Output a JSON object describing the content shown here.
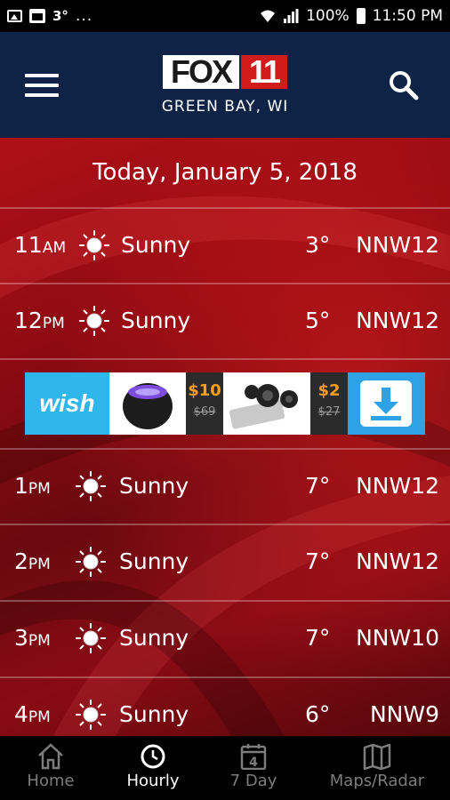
{
  "status_bar": {
    "temperature": "3°",
    "dots": "...",
    "battery": "100%",
    "time": "11:50 PM"
  },
  "header": {
    "logo_fox": "FOX",
    "logo_number": "11",
    "location": "GREEN BAY, WI"
  },
  "main": {
    "date": "Today, January 5, 2018",
    "hours": [
      {
        "hour": "11",
        "period": "AM",
        "condition": "Sunny",
        "temp": "3°",
        "wind": "NNW12"
      },
      {
        "hour": "12",
        "period": "PM",
        "condition": "Sunny",
        "temp": "5°",
        "wind": "NNW12"
      },
      {
        "hour": "1",
        "period": "PM",
        "condition": "Sunny",
        "temp": "7°",
        "wind": "NNW12"
      },
      {
        "hour": "2",
        "period": "PM",
        "condition": "Sunny",
        "temp": "7°",
        "wind": "NNW12"
      },
      {
        "hour": "3",
        "period": "PM",
        "condition": "Sunny",
        "temp": "7°",
        "wind": "NNW10"
      },
      {
        "hour": "4",
        "period": "PM",
        "condition": "Sunny",
        "temp": "6°",
        "wind": "NNW9"
      }
    ]
  },
  "ad": {
    "brand": "wish",
    "price1_now": "$10",
    "price1_was": "$69",
    "price2_now": "$2",
    "price2_was": "$27"
  },
  "bottom_nav": {
    "home": "Home",
    "hourly": "Hourly",
    "seven_day": "7 Day",
    "seven_day_icon_number": "4",
    "maps": "Maps/Radar"
  },
  "colors": {
    "header_bg": "#0f2346",
    "logo_red": "#d21b1b",
    "main_red": "#9e0d15",
    "wish_blue": "#2fb7ec",
    "price_orange": "#ff9d1a",
    "nav_inactive": "#7c7c7c"
  },
  "icons": [
    "image-icon",
    "calendar-icon",
    "wifi-icon",
    "signal-icon",
    "battery-icon",
    "menu-icon",
    "search-icon",
    "sun-icon",
    "download-icon",
    "home-icon",
    "clock-icon",
    "calendar-icon",
    "map-icon"
  ]
}
